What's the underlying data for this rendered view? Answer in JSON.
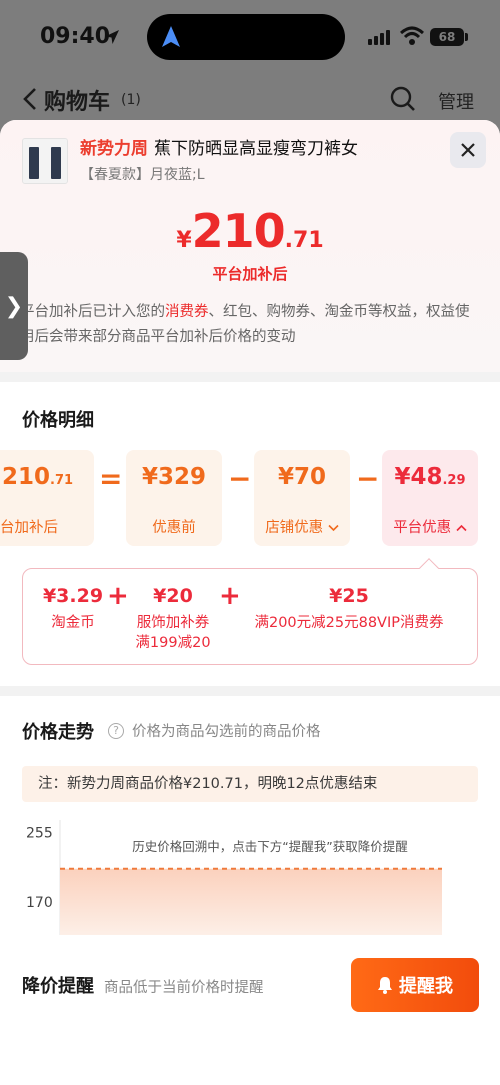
{
  "status_bar": {
    "time": "09:40",
    "battery": "68"
  },
  "nav": {
    "title": "购物车",
    "count": "(1)",
    "manage": "管理"
  },
  "product": {
    "tag": "新势力周",
    "name": "蕉下防晒显高显瘦弯刀裤女",
    "variant": "【春夏款】月夜蓝;L"
  },
  "price_summary": {
    "currency": "¥",
    "integer": "210",
    "decimal": ".71",
    "label": "平台加补后"
  },
  "notice": {
    "prefix": "平台加补后已计入您的",
    "highlight": "消费券",
    "suffix": "、红包、购物券、淘金币等权益，权益使用后会带来部分商品平台加补后价格的变动"
  },
  "side_tab_glyph": "❯",
  "price_detail": {
    "title": "价格明细",
    "boxes": [
      {
        "value": "210",
        "decimal": ".71",
        "label": "台加补后"
      },
      {
        "value": "¥329",
        "label": "优惠前"
      },
      {
        "value": "¥70",
        "label": "店铺优惠"
      },
      {
        "value": "¥48",
        "decimal": ".29",
        "label": "平台优惠"
      }
    ],
    "operators": [
      "=",
      "−",
      "−"
    ],
    "breakdown": [
      {
        "value": "¥3.29",
        "label": "淘金币"
      },
      {
        "value": "¥20",
        "label": "服饰加补券",
        "label2": "满199减20"
      },
      {
        "value": "¥25",
        "label": "满200元减25元88VIP消费券"
      }
    ],
    "plus": "+"
  },
  "trend": {
    "title": "价格走势",
    "info_glyph": "?",
    "subtitle": "价格为商品勾选前的商品价格",
    "note": "注：新势力周商品价格¥210.71，明晚12点优惠结束",
    "hint": "历史价格回溯中，点击下方“提醒我”获取降价提醒"
  },
  "chart_data": {
    "type": "area",
    "title": "",
    "xlabel": "",
    "ylabel": "",
    "ylim": [
      130,
      270
    ],
    "yticks": [
      255,
      170
    ],
    "series": [
      {
        "values": [
          210.71,
          210.71
        ]
      }
    ]
  },
  "reminder": {
    "title": "降价提醒",
    "subtitle": "商品低于当前价格时提醒",
    "button": "提醒我"
  },
  "colors": {
    "accent_red": "#ec2b2b",
    "accent_orange": "#f06a1c",
    "button_orange": "#f24c0c"
  }
}
